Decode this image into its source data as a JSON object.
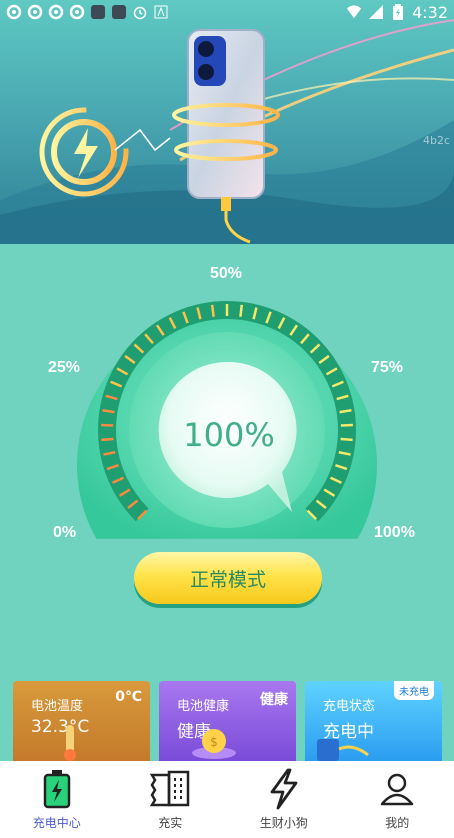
{
  "status_bar": {
    "time": "4:32"
  },
  "hero": {
    "watermark": "4b2c"
  },
  "gauge": {
    "label_0": "0%",
    "label_25": "25%",
    "label_50": "50%",
    "label_75": "75%",
    "label_100": "100%",
    "value_text": "100%",
    "level": 1.0
  },
  "mode_button": {
    "label": "正常模式"
  },
  "cards": [
    {
      "title": "电池温度",
      "value": "32.3°C",
      "tag": "0℃"
    },
    {
      "title": "电池健康",
      "value": "健康",
      "tag": "健康"
    },
    {
      "title": "充电状态",
      "value": "充电中",
      "tag": "未充电"
    }
  ],
  "tabs": [
    {
      "label": "充电中心",
      "icon": "battery-charging-icon"
    },
    {
      "label": "充实",
      "icon": "book-icon"
    },
    {
      "label": "生财小狗",
      "icon": "lightning-icon"
    },
    {
      "label": "我的",
      "icon": "user-icon"
    }
  ],
  "colors": {
    "accent": "#4c5bd4",
    "gauge": "#2fc493",
    "button": "#ffe34a"
  }
}
